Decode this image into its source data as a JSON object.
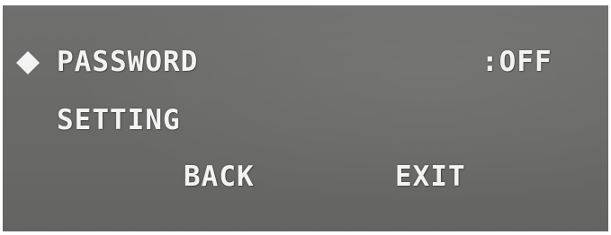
{
  "menu": {
    "cursor_icon": "diamond-icon",
    "items": [
      {
        "label": "PASSWORD",
        "value": ":OFF"
      },
      {
        "label": "SETTING"
      }
    ],
    "back_label": "BACK",
    "exit_label": "EXIT"
  },
  "colors": {
    "background": "#6b6b69",
    "text": "#f3f3f3"
  }
}
